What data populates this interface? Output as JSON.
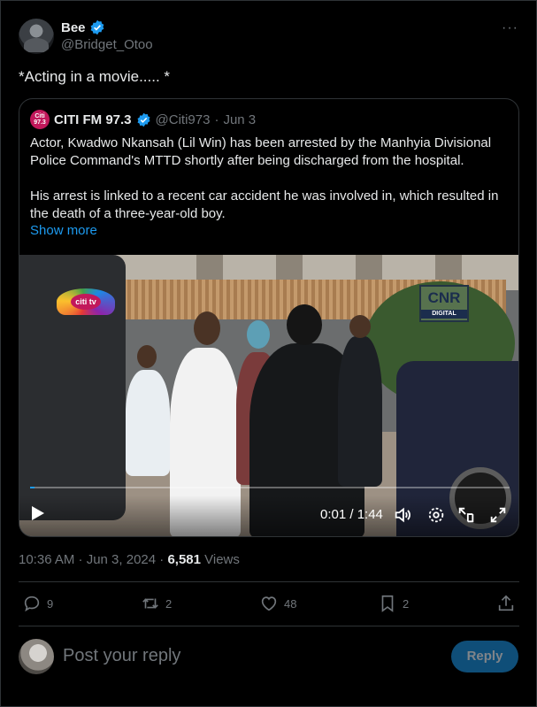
{
  "author": {
    "name": "Bee",
    "handle": "@Bridget_Otoo",
    "more_label": "···"
  },
  "tweet_text": "*Acting in a movie..... *",
  "quote": {
    "avatar_label": "Citi 97.3",
    "name": "CITI FM 97.3",
    "handle": "@Citi973",
    "separator": "·",
    "date": "Jun 3",
    "paragraph1": "Actor, Kwadwo Nkansah (Lil Win) has been arrested by the Manhyia Divisional Police Command's MTTD shortly after being discharged from the hospital.",
    "paragraph2": "His arrest is linked to a recent car accident he was involved in, which resulted in the death of a three-year-old boy.",
    "show_more": "Show more"
  },
  "video": {
    "watermark_left": "citi tv",
    "watermark_right": "CNR",
    "watermark_right_sub": "DIGITAL",
    "time": "0:01 / 1:44",
    "progress_fraction": 0.01
  },
  "meta": {
    "timestamp": "10:36 AM · Jun 3, 2024 · ",
    "views_count": "6,581",
    "views_label": " Views"
  },
  "actions": {
    "replies": "9",
    "reposts": "2",
    "likes": "48",
    "bookmarks": "2"
  },
  "reply": {
    "placeholder": "Post your reply",
    "button": "Reply"
  },
  "colors": {
    "accent": "#1d9bf0",
    "background": "#000000",
    "muted": "#71767b",
    "border": "#2f3336"
  }
}
